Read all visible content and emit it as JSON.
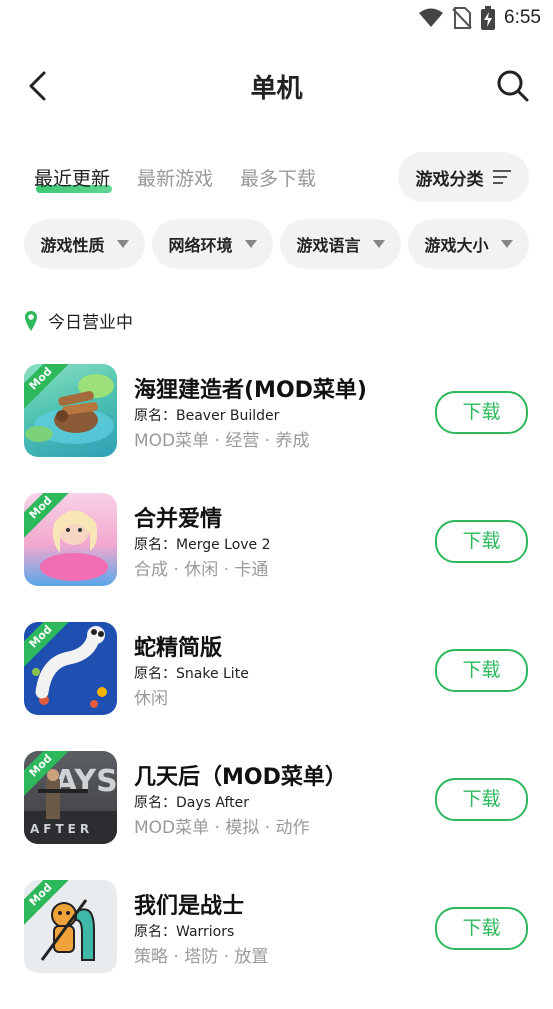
{
  "status_bar": {
    "time": "6:55"
  },
  "header": {
    "title": "单机"
  },
  "tabs": [
    {
      "label": "最近更新",
      "active": true
    },
    {
      "label": "最新游戏",
      "active": false
    },
    {
      "label": "最多下载",
      "active": false
    }
  ],
  "category_button": {
    "label": "游戏分类"
  },
  "filters": [
    {
      "label": "游戏性质"
    },
    {
      "label": "网络环境"
    },
    {
      "label": "游戏语言"
    },
    {
      "label": "游戏大小"
    }
  ],
  "section": {
    "title": "今日营业中"
  },
  "mod_badge": "Mod",
  "apps": [
    {
      "name": "海狸建造者(MOD菜单)",
      "original": "原名：Beaver Builder",
      "tags": "MOD菜单 · 经营 · 养成",
      "button": "下载",
      "icon": "beaver-builder-icon"
    },
    {
      "name": "合并爱情",
      "original": "原名：Merge Love 2",
      "tags": "合成 · 休闲 · 卡通",
      "button": "下载",
      "icon": "merge-love-icon"
    },
    {
      "name": "蛇精简版",
      "original": "原名：Snake Lite",
      "tags": "休闲",
      "button": "下载",
      "icon": "snake-lite-icon"
    },
    {
      "name": "几天后（MOD菜单）",
      "original": "原名：Days After",
      "tags": "MOD菜单 · 模拟 · 动作",
      "button": "下载",
      "icon": "days-after-icon",
      "icon_text_top": "AYS",
      "icon_text_bottom": "AFTER"
    },
    {
      "name": "我们是战士",
      "original": "原名：Warriors",
      "tags": "策略 · 塔防 · 放置",
      "button": "下载",
      "icon": "warriors-icon"
    }
  ],
  "colors": {
    "accent": "#2db85c",
    "chip_bg": "#f2f2f2",
    "muted_text": "#9a9a9a"
  }
}
